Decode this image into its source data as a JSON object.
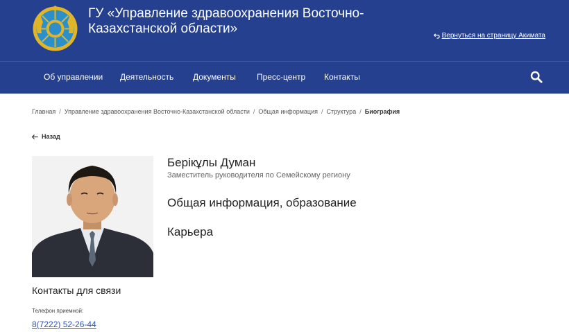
{
  "header": {
    "title": "ГУ «Управление здравоохранения Восточно-Казахстанской области»",
    "back_to_akimat": "Вернуться на страницу Акимата",
    "emblem_icon": "kazakhstan-emblem-icon",
    "background_color": "#24408e"
  },
  "nav": {
    "items": [
      {
        "label": "Об управлении"
      },
      {
        "label": "Деятельность"
      },
      {
        "label": "Документы"
      },
      {
        "label": "Пресс-центр"
      },
      {
        "label": "Контакты"
      }
    ],
    "search_icon": "search-icon"
  },
  "breadcrumb": {
    "items": [
      {
        "label": "Главная"
      },
      {
        "label": "Управление здравоохранения Восточно-Казахстанской области"
      },
      {
        "label": "Общая информация"
      },
      {
        "label": "Структура"
      },
      {
        "label": "Биография"
      }
    ],
    "separator": "/"
  },
  "back": {
    "label": "Назад",
    "icon": "arrow-left-icon"
  },
  "person": {
    "name": "Берікұлы Думан",
    "position": "Заместитель руководителя по Семейскому региону"
  },
  "sections": {
    "general": "Общая информация, образование",
    "career": "Карьера"
  },
  "contacts": {
    "heading": "Контакты для связи",
    "phone_label": "Телефон приемной:",
    "phone": "8(7222) 52-26-44",
    "link_color": "#2a55b5"
  }
}
